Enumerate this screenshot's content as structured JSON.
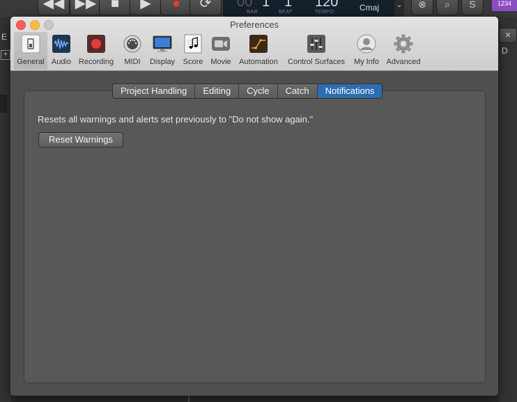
{
  "background_app": {
    "lcd": {
      "bar_value": "1",
      "beat_value": "1",
      "tempo_value": "120",
      "key_value": "Cmaj",
      "bar_label": "BAR",
      "beat_label": "BEAT",
      "tempo_label": "TEMPO"
    },
    "badge": "1234",
    "left_label": "E",
    "left_plus": "+",
    "right_label": "D",
    "right_button": "✕",
    "search_icon_glyph": "⌕",
    "solo_label": "S"
  },
  "window": {
    "title": "Preferences"
  },
  "toolbar": [
    {
      "label": "General",
      "icon": "general-icon"
    },
    {
      "label": "Audio",
      "icon": "audio-waveform-icon"
    },
    {
      "label": "Recording",
      "icon": "record-icon"
    },
    {
      "label": "MIDI",
      "icon": "midi-icon"
    },
    {
      "label": "Display",
      "icon": "display-icon"
    },
    {
      "label": "Score",
      "icon": "score-icon"
    },
    {
      "label": "Movie",
      "icon": "movie-icon"
    },
    {
      "label": "Automation",
      "icon": "automation-icon"
    },
    {
      "label": "Control Surfaces",
      "icon": "control-surfaces-icon"
    },
    {
      "label": "My Info",
      "icon": "my-info-icon"
    },
    {
      "label": "Advanced",
      "icon": "gear-icon"
    }
  ],
  "tabs": [
    "Project Handling",
    "Editing",
    "Cycle",
    "Catch",
    "Notifications"
  ],
  "active_tab": "Notifications",
  "notifications": {
    "description": "Resets all warnings and alerts set previously to \"Do not show again.\"",
    "reset_button": "Reset Warnings"
  },
  "colors": {
    "accent": "#2d6cb0",
    "record_red": "#e23b3b"
  }
}
